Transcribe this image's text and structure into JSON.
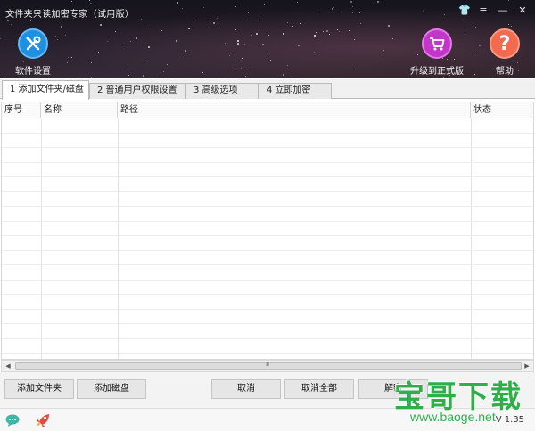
{
  "window": {
    "title": "文件夹只读加密专家（试用版）",
    "controls": [
      "👕",
      "≡",
      "—",
      "✕"
    ]
  },
  "header": {
    "settings_label": "软件设置",
    "upgrade_label": "升级到正式版",
    "help_label": "帮助",
    "help_glyph": "?",
    "colors": {
      "settings": "#1f8fe0",
      "upgrade": "#c236c8",
      "help": "#f26b4f"
    }
  },
  "tabs": [
    {
      "label": "1 添加文件夹/磁盘",
      "active": true
    },
    {
      "label": "2 普通用户权限设置",
      "active": false
    },
    {
      "label": "3 高级选项",
      "active": false
    },
    {
      "label": "4 立即加密",
      "active": false
    }
  ],
  "table": {
    "columns": [
      "序号",
      "名称",
      "路径",
      "状态"
    ],
    "rows": []
  },
  "scrollbar": {
    "grip": "III"
  },
  "actions": {
    "add_folder": "添加文件夹",
    "add_disk": "添加磁盘",
    "cancel": "取消",
    "cancel_all": "取消全部",
    "decrypt": "解密"
  },
  "statusbar": {
    "version": "V 1.35",
    "icons": [
      "chat-icon",
      "rocket-icon"
    ]
  },
  "watermark": {
    "title": "宝哥下载",
    "url": "www.baoge.net"
  }
}
